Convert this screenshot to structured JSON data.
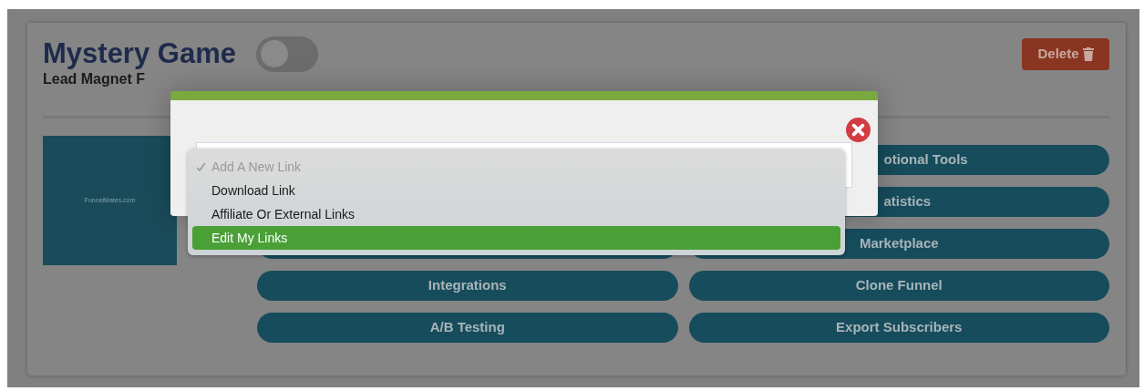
{
  "card": {
    "title": "Mystery Game",
    "toggle": {
      "on": false
    },
    "subtitle": "Lead Magnet F",
    "delete_button": "Delete",
    "thumbnail": {
      "caption": "FunnelMates.com"
    },
    "left_buttons": [
      {
        "kind": "blank"
      },
      {
        "kind": "text",
        "label": "Integrations"
      },
      {
        "kind": "text",
        "label": "A/B Testing"
      }
    ],
    "right_buttons": [
      {
        "label": "otional Tools",
        "cut": true
      },
      {
        "label": "atistics",
        "cut": true
      },
      {
        "label": "Marketplace",
        "cut": false
      },
      {
        "label": "Clone Funnel",
        "cut": false
      },
      {
        "label": "Export Subscribers",
        "cut": false
      }
    ]
  },
  "modal": {
    "dropdown": [
      {
        "label": "Add A New Link",
        "selected": true,
        "disabled": true,
        "highlighted": false
      },
      {
        "label": "Download Link",
        "selected": false,
        "disabled": false,
        "highlighted": false
      },
      {
        "label": "Affiliate Or External Links",
        "selected": false,
        "disabled": false,
        "highlighted": false
      },
      {
        "label": "Edit My Links",
        "selected": false,
        "disabled": false,
        "highlighted": true
      }
    ]
  }
}
